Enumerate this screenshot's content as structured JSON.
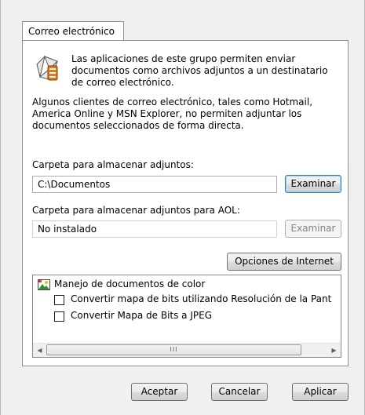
{
  "tab": {
    "label": "Correo electrónico"
  },
  "description": {
    "intro": "Las aplicaciones de este grupo permiten enviar documentos como archivos adjuntos a un destinatario de correo electrónico.",
    "note": "Algunos clientes de correo electrónico, tales como Hotmail, America Online y MSN Explorer, no permiten adjuntar los documentos seleccionados de forma directa."
  },
  "attachments_folder": {
    "label": "Carpeta para almacenar adjuntos:",
    "value": "C:\\Documentos",
    "browse_label": "Examinar"
  },
  "aol_folder": {
    "label": "Carpeta para almacenar adjuntos para AOL:",
    "value": "No instalado",
    "browse_label": "Examinar"
  },
  "internet_options_label": "Opciones de Internet",
  "color_docs": {
    "title": "Manejo de documentos de color",
    "options": [
      {
        "label": "Convertir mapa de bits utilizando Resolución de la Pant",
        "checked": false
      },
      {
        "label": "Convertir Mapa de Bits a JPEG",
        "checked": false
      }
    ],
    "scroll_left": "◀",
    "scroll_right": "▶",
    "thumb_grip": "III"
  },
  "footer": {
    "ok_label": "Aceptar",
    "cancel_label": "Cancelar",
    "apply_label": "Aplicar"
  },
  "icons": {
    "mail": "email-envelope-icon",
    "color": "color-image-icon"
  }
}
